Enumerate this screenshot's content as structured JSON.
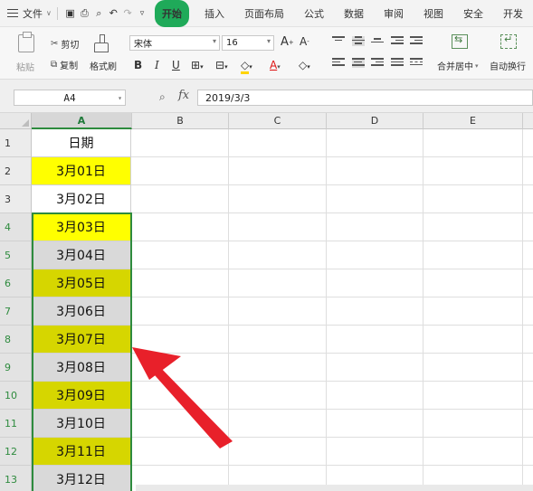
{
  "menu": {
    "file": "文件",
    "tabs": [
      "开始",
      "插入",
      "页面布局",
      "公式",
      "数据",
      "审阅",
      "视图",
      "安全",
      "开发"
    ]
  },
  "ribbon": {
    "paste": "粘贴",
    "cut": "剪切",
    "copy": "复制",
    "format_painter": "格式刷",
    "font_name": "宋体",
    "font_size": "16",
    "merge_center": "合并居中",
    "wrap_text": "自动换行"
  },
  "formula_bar": {
    "name_box": "A4",
    "fx_label": "fx",
    "formula": "2019/3/3"
  },
  "columns": [
    "A",
    "B",
    "C",
    "D",
    "E"
  ],
  "rows": [
    {
      "num": "1",
      "a": "日期",
      "fill": "#ffffff"
    },
    {
      "num": "2",
      "a": "3月01日",
      "fill": "#ffff00"
    },
    {
      "num": "3",
      "a": "3月02日",
      "fill": "#ffffff"
    },
    {
      "num": "4",
      "a": "3月03日",
      "fill": "#ffff00"
    },
    {
      "num": "5",
      "a": "3月04日",
      "fill": "#d9d9d9"
    },
    {
      "num": "6",
      "a": "3月05日",
      "fill": "#d6d600"
    },
    {
      "num": "7",
      "a": "3月06日",
      "fill": "#d9d9d9"
    },
    {
      "num": "8",
      "a": "3月07日",
      "fill": "#d6d600"
    },
    {
      "num": "9",
      "a": "3月08日",
      "fill": "#d9d9d9"
    },
    {
      "num": "10",
      "a": "3月09日",
      "fill": "#d6d600"
    },
    {
      "num": "11",
      "a": "3月10日",
      "fill": "#d9d9d9"
    },
    {
      "num": "12",
      "a": "3月11日",
      "fill": "#d6d600"
    },
    {
      "num": "13",
      "a": "3月12日",
      "fill": "#d9d9d9"
    }
  ],
  "colors": {
    "accent_green": "#1faa59",
    "selection_border": "#2e8b3e",
    "annotation_arrow": "#e8202a"
  }
}
